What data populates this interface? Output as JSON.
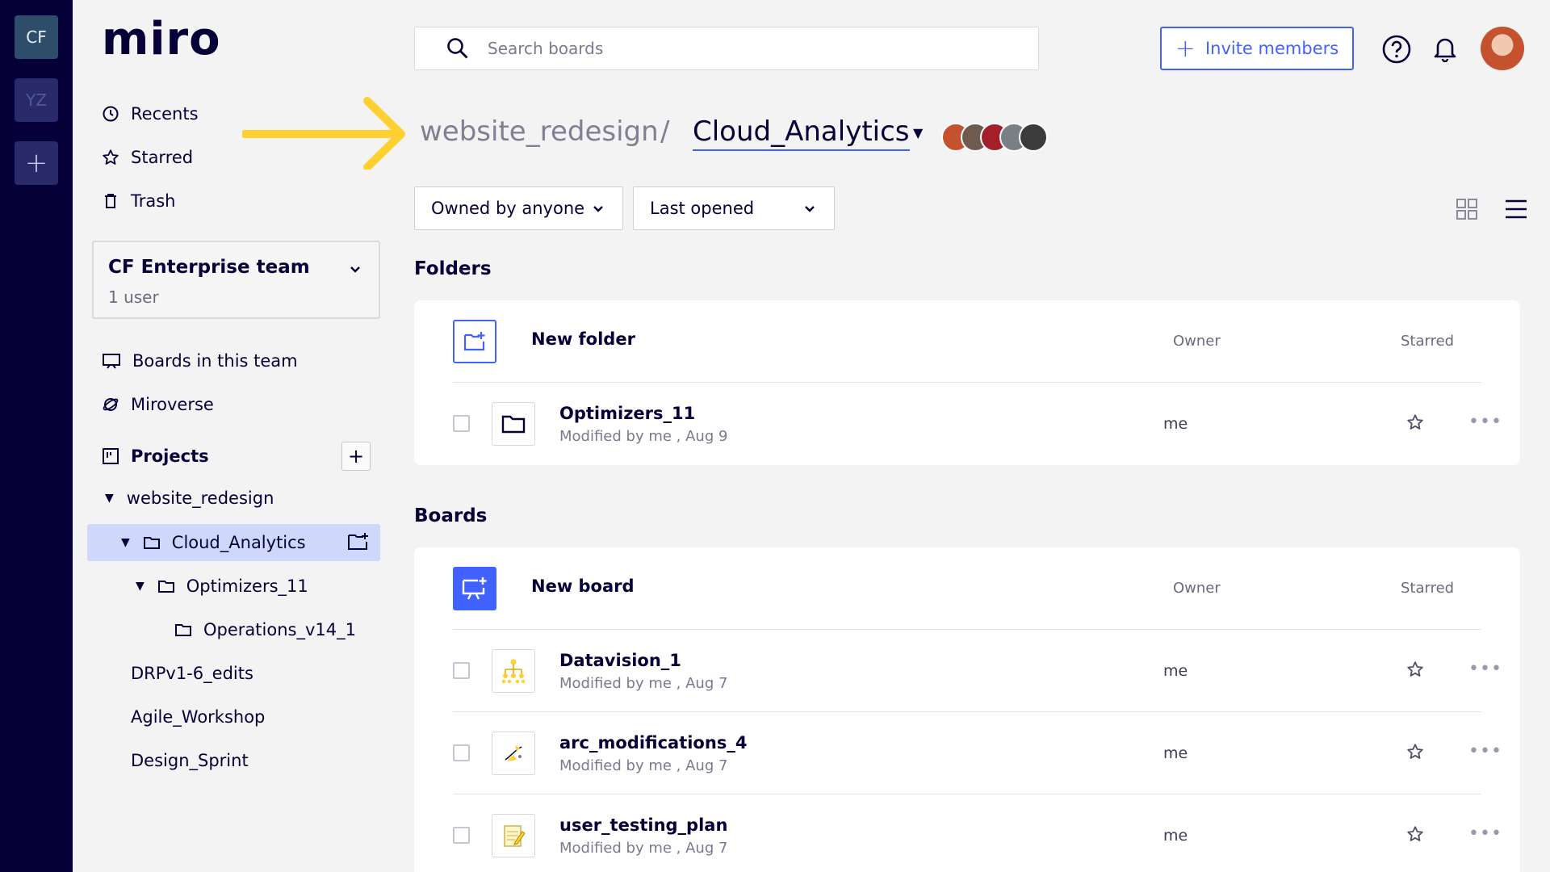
{
  "rail": {
    "team1": "CF",
    "team2": "YZ",
    "add": "+"
  },
  "sidebar": {
    "logo": "miro",
    "nav": [
      {
        "label": "Recents",
        "icon": "clock-icon"
      },
      {
        "label": "Starred",
        "icon": "star-icon"
      },
      {
        "label": "Trash",
        "icon": "trash-icon"
      }
    ],
    "team": {
      "name": "CF Enterprise team",
      "users": "1 user"
    },
    "boards_in_team": "Boards in this team",
    "miroverse": "Miroverse",
    "projects": "Projects",
    "projects_add": "+",
    "tree": {
      "project": "website_redesign",
      "selected": "Cloud_Analytics",
      "sub": "Optimizers_11",
      "subsub": "Operations_v14_1",
      "others": [
        "DRPv1-6_edits",
        "Agile_Workshop",
        "Design_Sprint"
      ]
    }
  },
  "header": {
    "search_placeholder": "Search boards",
    "invite": "Invite members",
    "invite_plus": "+"
  },
  "breadcrumb": {
    "parent": "website_redesign",
    "separator": "/",
    "current": "Cloud_Analytics"
  },
  "filters": {
    "owner": "Owned by anyone",
    "sort": "Last opened"
  },
  "folders": {
    "title": "Folders",
    "new_label": "New folder",
    "col_owner": "Owner",
    "col_starred": "Starred",
    "items": [
      {
        "name": "Optimizers_11",
        "meta": "Modified by me , Aug 9",
        "owner": "me"
      }
    ]
  },
  "boards": {
    "title": "Boards",
    "new_label": "New board",
    "col_owner": "Owner",
    "col_starred": "Starred",
    "items": [
      {
        "name": "Datavision_1",
        "meta": "Modified by me , Aug 7",
        "owner": "me"
      },
      {
        "name": "arc_modifications_4",
        "meta": "Modified by me , Aug 7",
        "owner": "me"
      },
      {
        "name": "user_testing_plan",
        "meta": "Modified by me , Aug 7",
        "owner": "me"
      }
    ]
  },
  "more": "•••",
  "colors": {
    "brand": "#050038",
    "accent": "#4262ff",
    "selected": "#cfd7fb",
    "arrow": "#ffd02f"
  }
}
